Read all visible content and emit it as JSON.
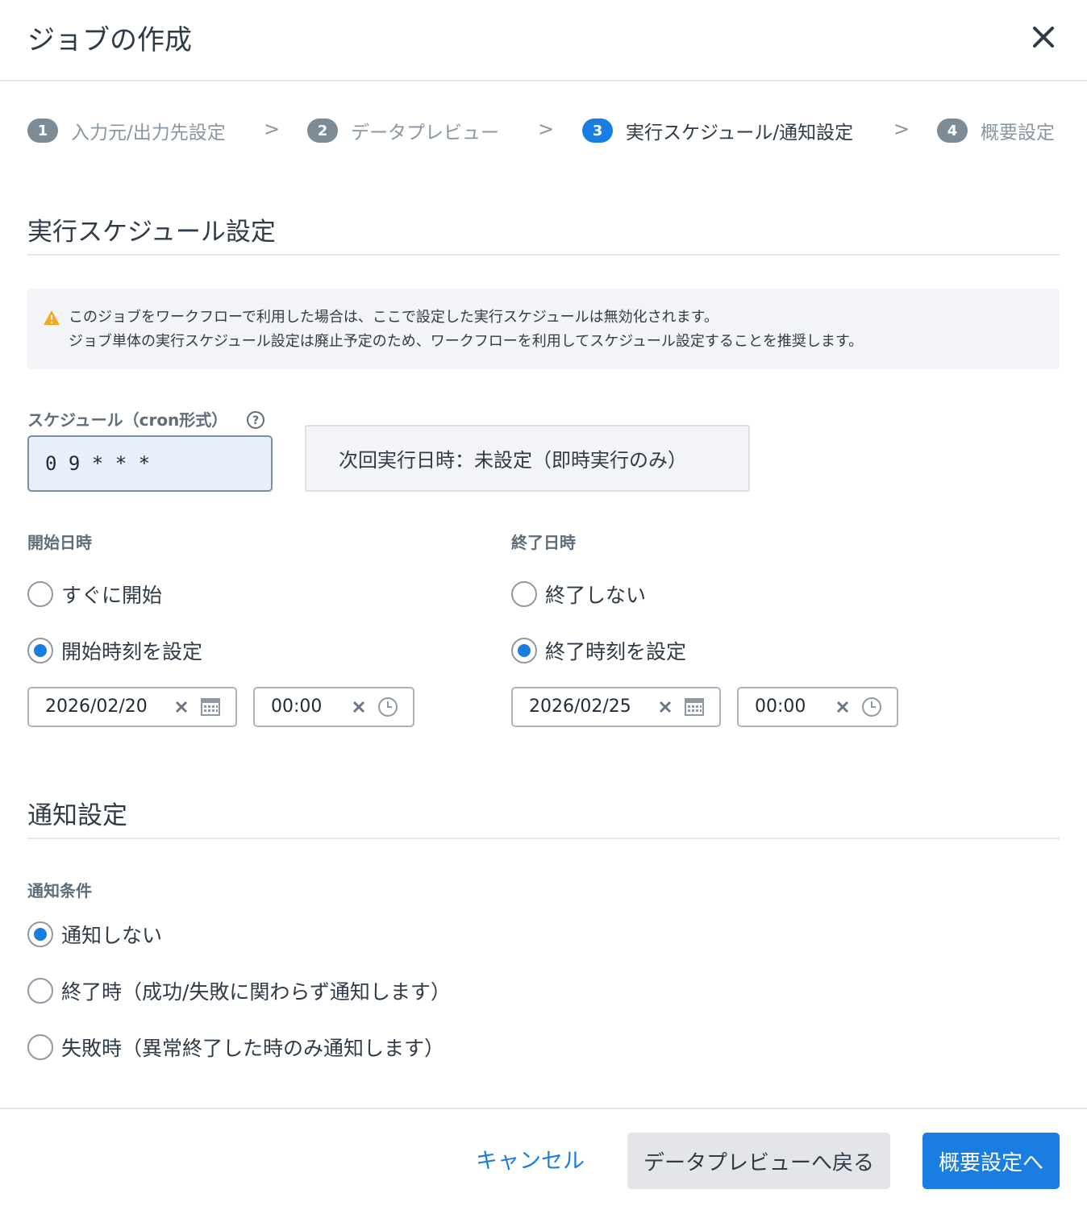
{
  "dialog": {
    "title": "ジョブの作成",
    "close_icon": "close-icon"
  },
  "stepper": {
    "separator": ">",
    "current_step": 3,
    "steps": [
      {
        "number": "1",
        "label": "入力元/出力先設定"
      },
      {
        "number": "2",
        "label": "データプレビュー"
      },
      {
        "number": "3",
        "label": "実行スケジュール/通知設定"
      },
      {
        "number": "4",
        "label": "概要設定"
      }
    ]
  },
  "schedule_section": {
    "title": "実行スケジュール設定",
    "warning": {
      "icon": "warning-icon",
      "line1": "このジョブをワークフローで利用した場合は、ここで設定した実行スケジュールは無効化されます。",
      "line2": "ジョブ単体の実行スケジュール設定は廃止予定のため、ワークフローを利用してスケジュール設定することを推奨します。"
    },
    "cron": {
      "label": "スケジュール（cron形式）",
      "help_icon": "question-circle-icon",
      "value": "0 9 * * *"
    },
    "next_run": "次回実行日時：未設定（即時実行のみ）",
    "start": {
      "label": "開始日時",
      "options": [
        "すぐに開始",
        "開始時刻を設定"
      ],
      "selected": "開始時刻を設定",
      "date": "2026/02/20",
      "time": "00:00"
    },
    "end": {
      "label": "終了日時",
      "options": [
        "終了しない",
        "終了時刻を設定"
      ],
      "selected": "終了時刻を設定",
      "date": "2026/02/25",
      "time": "00:00"
    }
  },
  "notify_section": {
    "title": "通知設定",
    "condition_label": "通知条件",
    "options": [
      "通知しない",
      "終了時（成功/失敗に関わらず通知します）",
      "失敗時（異常終了した時のみ通知します）"
    ],
    "selected": "通知しない"
  },
  "footer": {
    "cancel": "キャンセル",
    "back": "データプレビューへ戻る",
    "next": "概要設定へ"
  },
  "colors": {
    "primary": "#1a7de2",
    "warning": "#f5a623",
    "text": "#2f3b48",
    "muted": "#8a96a2",
    "panel_bg": "#f3f4f7"
  }
}
